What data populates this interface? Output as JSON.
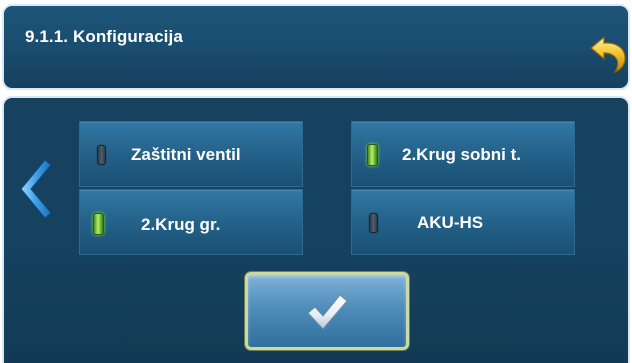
{
  "header": {
    "title": "9.1.1. Konfiguracija",
    "back_icon": "undo-arrow-icon"
  },
  "navigation": {
    "prev_icon": "chevron-left-icon"
  },
  "options": [
    {
      "label": "Zaštitni ventil",
      "state": "off"
    },
    {
      "label": "2.Krug sobni t.",
      "state": "on"
    },
    {
      "label": "2.Krug gr.",
      "state": "on"
    },
    {
      "label": "AKU-HS",
      "state": "off"
    }
  ],
  "confirm": {
    "icon": "checkmark-icon"
  },
  "colors": {
    "background": "#15425f",
    "header": "#1a4d6f",
    "led_on": "#7fd34a",
    "led_off": "#3a4a55",
    "confirm_border": "#cdd9a5"
  }
}
